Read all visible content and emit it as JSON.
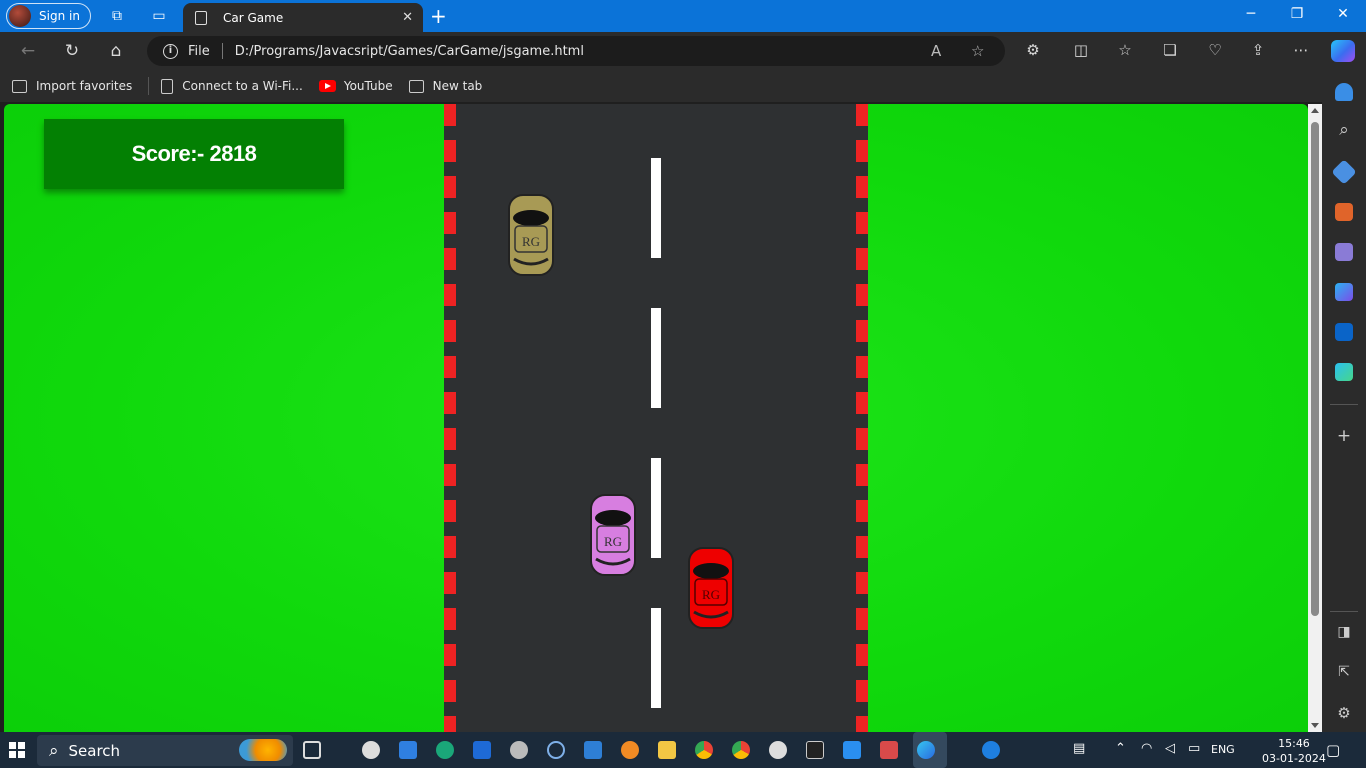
{
  "browser": {
    "signin_label": "Sign in",
    "tab_title": "Car Game",
    "address_protocol": "File",
    "address_url": "D:/Programs/Javacsript/Games/CarGame/jsgame.html"
  },
  "bookmarks": [
    {
      "label": "Import favorites"
    },
    {
      "label": "Connect to a Wi-Fi..."
    },
    {
      "label": "YouTube"
    },
    {
      "label": "New tab"
    }
  ],
  "game": {
    "score_text": "Score:- 2818",
    "score": 2818,
    "car_label": "RG",
    "colors": {
      "grass": "#10d90c",
      "road": "#2e3032",
      "curb_red": "#ee2323",
      "score_box": "#038003",
      "player_car": "#ee0000",
      "enemy_car_olive": "#a89a55",
      "enemy_car_violet": "#d77ee0"
    }
  },
  "taskbar": {
    "search_label": "Search",
    "language": "ENG",
    "time": "15:46",
    "date": "03-01-2024"
  }
}
